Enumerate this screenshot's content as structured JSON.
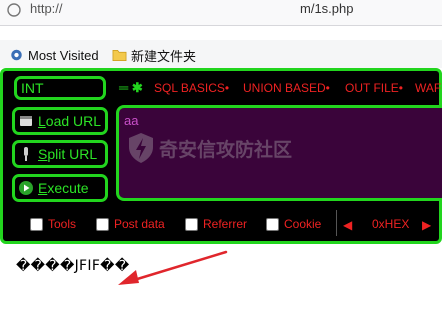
{
  "browser": {
    "url_left": "http://",
    "url_right": "m/1s.php"
  },
  "bookmarks": [
    {
      "label": "Most Visited",
      "icon": "gear-icon"
    },
    {
      "label": "新建文件夹",
      "icon": "folder-icon"
    }
  ],
  "hackbar": {
    "select_value": "INT",
    "menus": [
      "SQL BASICS•",
      "UNION BASED•",
      "OUT FILE•",
      "WAF"
    ],
    "buttons": {
      "load": {
        "first": "L",
        "rest": "oad URL",
        "icon": "page-icon"
      },
      "split": {
        "first": "S",
        "rest": "plit URL",
        "icon": "scissors-icon"
      },
      "execute": {
        "first": "E",
        "rest": "xecute",
        "icon": "play-icon"
      }
    },
    "textarea_value": "aa",
    "watermark_text": "奇安信攻防社区",
    "checkboxes": [
      "Tools",
      "Post data",
      "Referrer",
      "Cookie"
    ],
    "hex_label": "0xHEX",
    "colors": {
      "accent": "#22d51e",
      "menu_text": "#ee2222",
      "textarea_bg": "#3a043a"
    }
  },
  "page": {
    "output_text": "����JFIF��"
  }
}
